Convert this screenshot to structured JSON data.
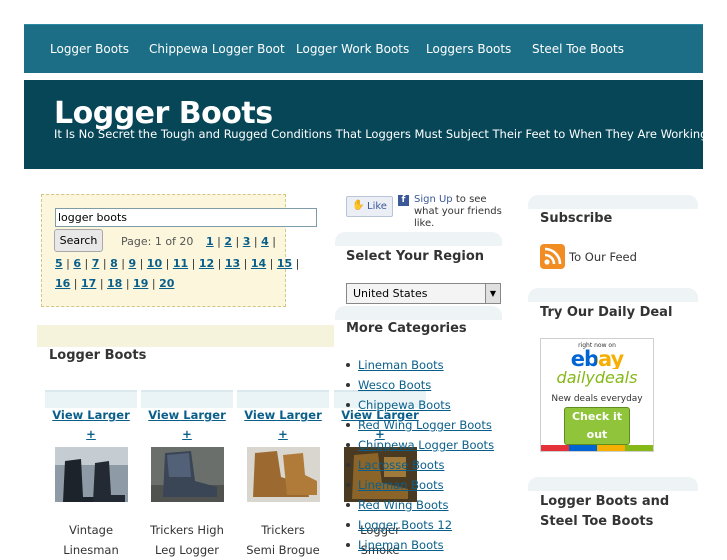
{
  "nav": {
    "items": [
      "Logger Boots",
      "Chippewa Logger Boot",
      "Logger Work Boots",
      "Loggers Boots",
      "Steel Toe Boots"
    ]
  },
  "header": {
    "title": "Logger Boots",
    "description": "It Is No Secret the Tough and Rugged Conditions That Loggers Must Subject Their Feet to When They Are Working."
  },
  "search": {
    "value": "logger boots",
    "button_label": "Search",
    "page_info": "Page: 1 of 20",
    "pages_row1": [
      "1",
      "2",
      "3",
      "4"
    ],
    "pages_row2": [
      "5",
      "6",
      "7",
      "8",
      "9",
      "10",
      "11",
      "12",
      "13",
      "14",
      "15"
    ],
    "pages_row3": [
      "16",
      "17",
      "18",
      "19",
      "20"
    ]
  },
  "products": {
    "title": "Logger Boots",
    "view_label": "View Larger",
    "plus_label": "+",
    "items": [
      {
        "name_l1": "Vintage",
        "name_l2": "Linesman"
      },
      {
        "name_l1": "Trickers High",
        "name_l2": "Leg Logger"
      },
      {
        "name_l1": "Trickers",
        "name_l2": "Semi Brogue"
      },
      {
        "name_l1": "Logger",
        "name_l2": "Smoke"
      }
    ]
  },
  "facebook": {
    "like_label": "Like",
    "signup_link": "Sign Up",
    "signup_text": " to see what your friends like."
  },
  "region": {
    "title": "Select Your Region",
    "selected": "United States"
  },
  "categories": {
    "title": "More Categories",
    "items": [
      "Lineman Boots",
      "Wesco Boots",
      "Chippewa Boots",
      "Red Wing Logger Boots",
      "Chippewa Logger Boots",
      "Lacrosse Boots",
      "Lineman Boots",
      "Red Wing Boots",
      "Logger Boots 12",
      "Lineman Boots"
    ]
  },
  "subscribe": {
    "title": "Subscribe",
    "feed_text": "To Our Feed",
    "icon": "rss-feed-icon"
  },
  "daily_deal": {
    "title": "Try Our Daily Deal",
    "right_now_on": "right now on",
    "ebay": "ebay",
    "daily_deals": "dailydeals",
    "new_deals": "New deals everyday",
    "check_it_out": "Check it out"
  },
  "widget3": {
    "title_l1": "Logger Boots and",
    "title_l2": "Steel Toe Boots"
  },
  "colors": {
    "nav": "#1c6e86",
    "header": "#074657",
    "link": "#0a5f8a",
    "search_bg": "#fcf7dc"
  }
}
